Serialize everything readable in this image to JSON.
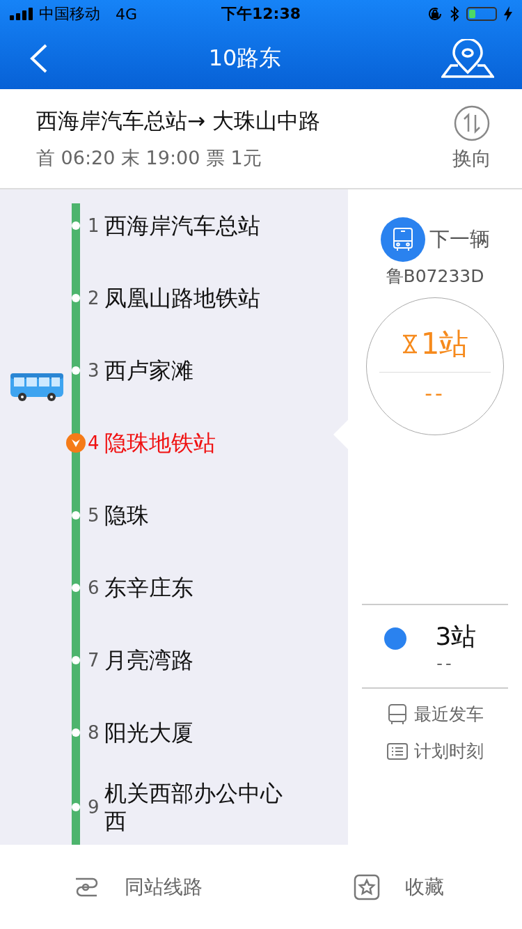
{
  "status_bar": {
    "carrier": "中国移动",
    "network": "4G",
    "time": "下午12:38"
  },
  "nav": {
    "title": "10路东"
  },
  "route": {
    "direction": "西海岸汽车总站→ 大珠山中路",
    "schedule": "首 06:20 末 19:00 票 1元",
    "switch_label": "换向"
  },
  "stops": [
    {
      "number": "1",
      "name": "西海岸汽车总站",
      "selected": false,
      "bus_approaching": false
    },
    {
      "number": "2",
      "name": "凤凰山路地铁站",
      "selected": false,
      "bus_approaching": false
    },
    {
      "number": "3",
      "name": "西卢家滩",
      "selected": false,
      "bus_approaching": true
    },
    {
      "number": "4",
      "name": "隐珠地铁站",
      "selected": true,
      "bus_approaching": false
    },
    {
      "number": "5",
      "name": "隐珠",
      "selected": false,
      "bus_approaching": false
    },
    {
      "number": "6",
      "name": "东辛庄东",
      "selected": false,
      "bus_approaching": false
    },
    {
      "number": "7",
      "name": "月亮湾路",
      "selected": false,
      "bus_approaching": false
    },
    {
      "number": "8",
      "name": "阳光大厦",
      "selected": false,
      "bus_approaching": false
    },
    {
      "number": "9",
      "name": "机关西部办公中心西",
      "selected": false,
      "bus_approaching": false
    }
  ],
  "next_bus": {
    "label": "下一辆",
    "plate": "鲁B07233D",
    "stops_away": "1站",
    "eta": "--"
  },
  "second_bus": {
    "stops_away": "3站",
    "eta": "--",
    "color": "#2a82ef"
  },
  "links": [
    {
      "kind": "bus",
      "label": "最近发车"
    },
    {
      "kind": "list",
      "label": "计划时刻"
    }
  ],
  "bottom_bar": [
    {
      "kind": "route",
      "label": "同站线路"
    },
    {
      "kind": "star",
      "label": "收藏"
    }
  ]
}
